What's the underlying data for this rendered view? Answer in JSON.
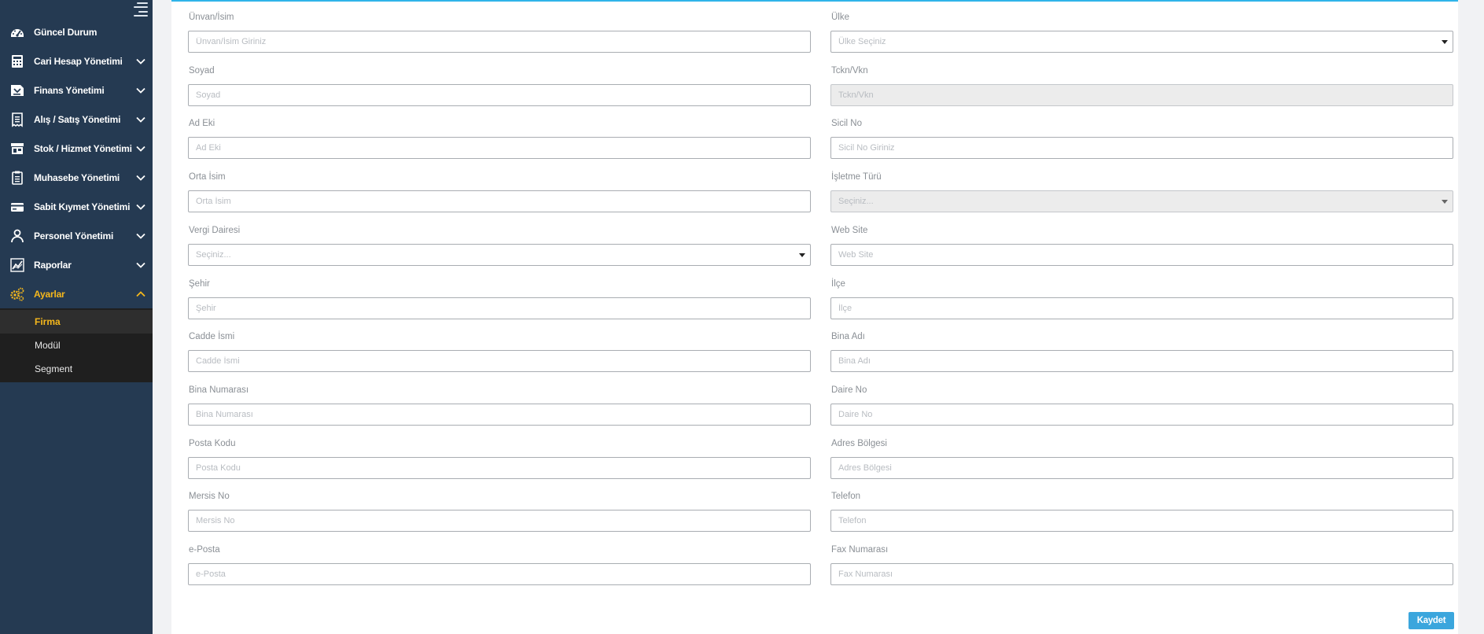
{
  "sidebar": {
    "items": [
      {
        "key": "guncel",
        "label": "Güncel Durum",
        "icon": "dashboard-icon",
        "expandable": false
      },
      {
        "key": "cari",
        "label": "Cari Hesap Yönetimi",
        "icon": "calculator-icon",
        "expandable": true
      },
      {
        "key": "finans",
        "label": "Finans Yönetimi",
        "icon": "finance-icon",
        "expandable": true
      },
      {
        "key": "alis",
        "label": "Alış / Satış Yönetimi",
        "icon": "receipt-icon",
        "expandable": true
      },
      {
        "key": "stok",
        "label": "Stok / Hizmet Yönetimi",
        "icon": "store-icon",
        "expandable": true
      },
      {
        "key": "muhasebe",
        "label": "Muhasebe Yönetimi",
        "icon": "clipboard-icon",
        "expandable": true
      },
      {
        "key": "sabit",
        "label": "Sabit Kıymet Yönetimi",
        "icon": "card-icon",
        "expandable": true
      },
      {
        "key": "personel",
        "label": "Personel Yönetimi",
        "icon": "user-icon",
        "expandable": true
      },
      {
        "key": "raporlar",
        "label": "Raporlar",
        "icon": "chart-icon",
        "expandable": true
      },
      {
        "key": "ayarlar",
        "label": "Ayarlar",
        "icon": "gears-icon",
        "expandable": true,
        "active": true
      }
    ],
    "submenu": [
      {
        "label": "Firma",
        "active": true
      },
      {
        "label": "Modül"
      },
      {
        "label": "Segment"
      }
    ],
    "active_color": "#f6b81c"
  },
  "form": {
    "left": [
      {
        "label": "Ünvan/İsim",
        "placeholder": "Ünvan/İsim Giriniz",
        "type": "input"
      },
      {
        "label": "Soyad",
        "placeholder": "Soyad",
        "type": "input"
      },
      {
        "label": "Ad Eki",
        "placeholder": "Ad Eki",
        "type": "input"
      },
      {
        "label": "Orta İsim",
        "placeholder": "Orta İsim",
        "type": "input"
      },
      {
        "label": "Vergi Dairesi",
        "placeholder": "Seçiniz...",
        "type": "select"
      },
      {
        "label": "Şehir",
        "placeholder": "Şehir",
        "type": "input"
      },
      {
        "label": "Cadde İsmi",
        "placeholder": "Cadde İsmi",
        "type": "input"
      },
      {
        "label": "Bina Numarası",
        "placeholder": "Bina Numarası",
        "type": "input"
      },
      {
        "label": "Posta Kodu",
        "placeholder": "Posta Kodu",
        "type": "input"
      },
      {
        "label": "Mersis No",
        "placeholder": "Mersis No",
        "type": "input"
      },
      {
        "label": "e-Posta",
        "placeholder": "e-Posta",
        "type": "input"
      }
    ],
    "right": [
      {
        "label": "Ülke",
        "placeholder": "Ülke Seçiniz",
        "type": "select"
      },
      {
        "label": "Tckn/Vkn",
        "placeholder": "Tckn/Vkn",
        "type": "input",
        "disabled": true
      },
      {
        "label": "Sicil No",
        "placeholder": "Sicil No Giriniz",
        "type": "input"
      },
      {
        "label": "İşletme Türü",
        "placeholder": "Seçiniz...",
        "type": "select",
        "disabled": true
      },
      {
        "label": "Web Site",
        "placeholder": "Web Site",
        "type": "input"
      },
      {
        "label": "İlçe",
        "placeholder": "İlçe",
        "type": "input"
      },
      {
        "label": "Bina Adı",
        "placeholder": "Bina Adı",
        "type": "input"
      },
      {
        "label": "Daire No",
        "placeholder": "Daire No",
        "type": "input"
      },
      {
        "label": "Adres Bölgesi",
        "placeholder": "Adres Bölgesi",
        "type": "input"
      },
      {
        "label": "Telefon",
        "placeholder": "Telefon",
        "type": "input"
      },
      {
        "label": "Fax Numarası",
        "placeholder": "Fax Numarası",
        "type": "input"
      }
    ],
    "save_label": "Kaydet",
    "accent_color": "#2fb4e9",
    "button_color": "#3ba6dd"
  }
}
